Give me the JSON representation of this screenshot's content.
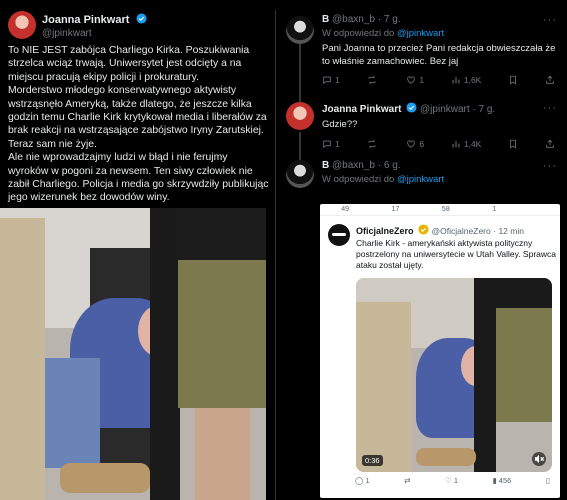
{
  "main_tweet": {
    "author": "Joanna Pinkwart",
    "handle": "@jpinkwart",
    "paragraphs": [
      "To NIE JEST zabójca Charliego Kirka. Poszukiwania strzelca wciąż trwają. Uniwersytet jest odcięty a na miejscu pracują ekipy policji i prokuratury.",
      "Morderstwo młodego konserwatywnego aktywisty wstrząsnęło Ameryką, także dlatego, że jeszcze kilka godzin temu Charlie Kirk krytykował media i liberałów za brak reakcji na wstrząsające zabójstwo Iryny Zarutskiej. Teraz sam nie żyje.",
      "Ale nie wprowadzajmy ludzi w błąd i nie ferujmy wyroków w pogoni za newsem. Ten siwy człowiek nie zabił Charliego. Policja i media go skrzywdziły publikując jego wizerunek bez dowodów winy."
    ]
  },
  "replies": [
    {
      "author": "B",
      "handle": "@baxn_b",
      "time": "· 7 g.",
      "reply_to_label": "W odpowiedzi do",
      "reply_to": "@jpinkwart",
      "text": "Pani Joanna to przecież Pani redakcja obwieszczała że to właśnie zamachowiec. Bez jaj",
      "stats": {
        "replies": "1",
        "reposts": "",
        "likes": "1",
        "views": "1,6K"
      }
    },
    {
      "author": "Joanna Pinkwart",
      "handle": "@jpinkwart",
      "time": "· 7 g.",
      "text": "Gdzie??",
      "stats": {
        "replies": "1",
        "reposts": "",
        "likes": "6",
        "views": "1,4K"
      }
    },
    {
      "author": "B",
      "handle": "@baxn_b",
      "time": "· 6 g.",
      "reply_to_label": "W odpowiedzi do",
      "reply_to": "@jpinkwart"
    }
  ],
  "embedded": {
    "top_stats": [
      "49",
      "17",
      "58",
      "1",
      ""
    ],
    "author": "OficjalneZero",
    "handle": "@OficjalneZero",
    "time": "· 12 min",
    "text": "Charlie Kirk - amerykański aktywista polityczny postrzelony na uniwersytecie w Utah Valley. Sprawca ataku został ujęty.",
    "video_time": "0:36",
    "stats": {
      "replies": "1",
      "reposts": "",
      "likes": "1",
      "views": "456"
    }
  },
  "icons": {
    "reply": "reply-icon",
    "repost": "repost-icon",
    "like": "heart-icon",
    "views": "chart-icon",
    "bookmark": "bookmark-icon",
    "share": "share-icon",
    "more": "more-icon",
    "verified": "verified-badge-icon"
  },
  "colors": {
    "accent": "#1d9bf0",
    "background": "#000000",
    "muted": "#71767b"
  }
}
